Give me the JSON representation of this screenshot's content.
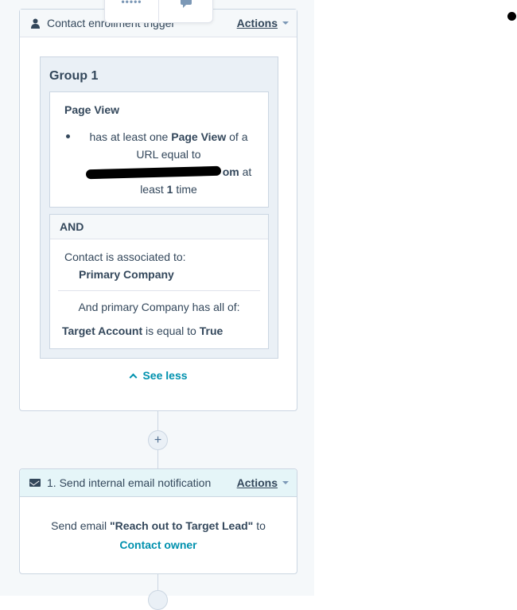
{
  "trigger": {
    "title": "Contact enrollment trigger",
    "actions_label": "Actions",
    "group_title": "Group 1",
    "filter": {
      "title": "Page View",
      "text_1": "has at least one ",
      "bold_1": "Page View",
      "text_2": " of a URL equal to ",
      "url_suffix": "om",
      "text_3": " at least ",
      "count": "1",
      "text_4": " time"
    },
    "and_block": {
      "label": "AND",
      "assoc_text": "Contact is associated to:",
      "assoc_value": "Primary Company",
      "primary_text": "And primary Company has all of:",
      "target_prop": "Target Account",
      "target_mid": " is equal to ",
      "target_val": "True"
    },
    "see_less": "See less"
  },
  "add_button": "+",
  "action": {
    "title": "1. Send internal email notification",
    "actions_label": "Actions",
    "send_prefix": "Send email ",
    "email_name": "\"Reach out to Target Lead\"",
    "send_mid": " to",
    "recipient": "Contact owner"
  },
  "colors": {
    "link": "#0091ae",
    "text": "#33475b",
    "border": "#cbd6e2",
    "canvas": "#f5f8fa"
  }
}
